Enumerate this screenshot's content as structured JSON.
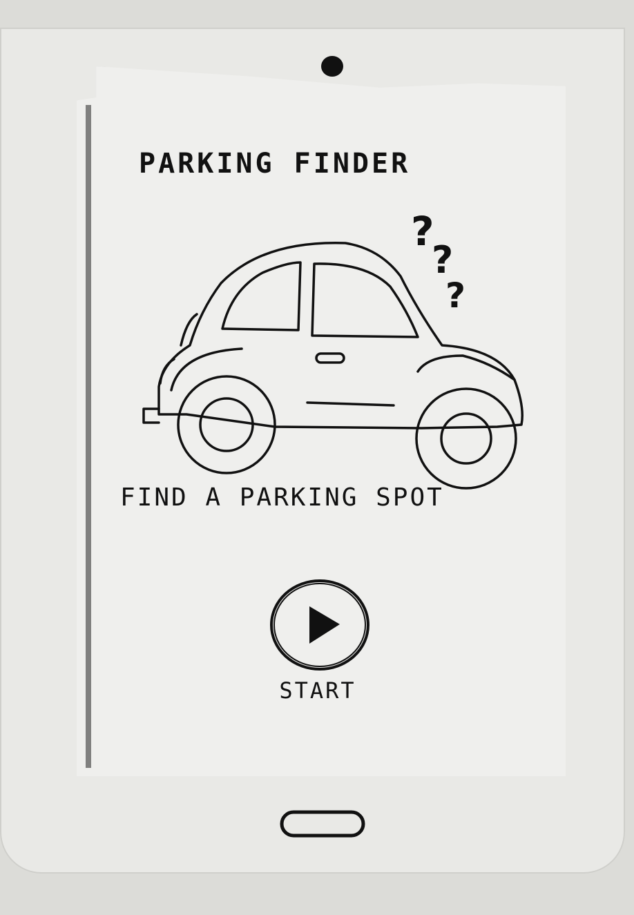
{
  "app": {
    "title": "PARKING FINDER",
    "subtitle": "FIND A PARKING SPOT"
  },
  "start_button": {
    "label": "START",
    "icon": "play-icon"
  },
  "home_button": {
    "icon": "home-button-icon"
  },
  "illustration": {
    "icon": "car-illustration"
  },
  "colors": {
    "ink": "#111111",
    "paper": "#efefed"
  }
}
